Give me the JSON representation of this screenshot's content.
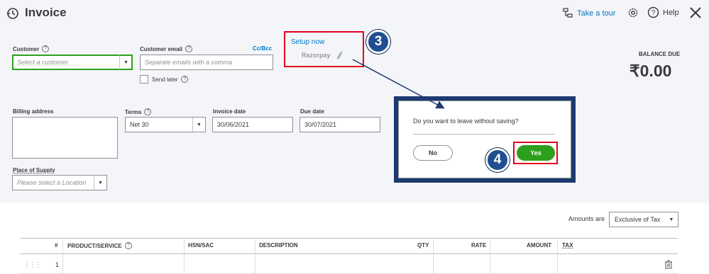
{
  "header": {
    "title": "Invoice",
    "take_a_tour": "Take a tour",
    "help": "Help"
  },
  "form": {
    "customer": {
      "label": "Customer",
      "placeholder": "Select a customer"
    },
    "customer_email": {
      "label": "Customer email",
      "placeholder": "Separate emails with a comma",
      "cc_bcc": "Cc/Bcc"
    },
    "send_later": "Send later",
    "billing_address": {
      "label": "Billing address",
      "value": ""
    },
    "terms": {
      "label": "Terms",
      "value": "Net 30"
    },
    "invoice_date": {
      "label": "Invoice date",
      "value": "30/06/2021"
    },
    "due_date": {
      "label": "Due date",
      "value": "30/07/2021"
    },
    "place_of_supply": {
      "label": "Place of Supply",
      "placeholder": "Please select a Location"
    }
  },
  "payments": {
    "setup_now": "Setup now",
    "provider": "Razorpay"
  },
  "balance": {
    "label": "BALANCE DUE",
    "amount": "₹0.00"
  },
  "dialog": {
    "message": "Do you want to leave without saving?",
    "no_label": "No",
    "yes_label": "Yes"
  },
  "annotations": {
    "marker_3": "3",
    "marker_4": "4"
  },
  "table": {
    "amounts_are_label": "Amounts are",
    "amounts_are_value": "Exclusive of Tax",
    "columns": [
      "#",
      "PRODUCT/SERVICE",
      "HSN/SAC",
      "DESCRIPTION",
      "QTY",
      "RATE",
      "AMOUNT",
      "TAX"
    ],
    "rows": [
      {
        "num": "1"
      }
    ]
  },
  "colors": {
    "brand_green": "#2ca01c",
    "link_blue": "#0077c5",
    "highlight_red": "#e1001c",
    "marker_navy": "#1f4e91"
  }
}
